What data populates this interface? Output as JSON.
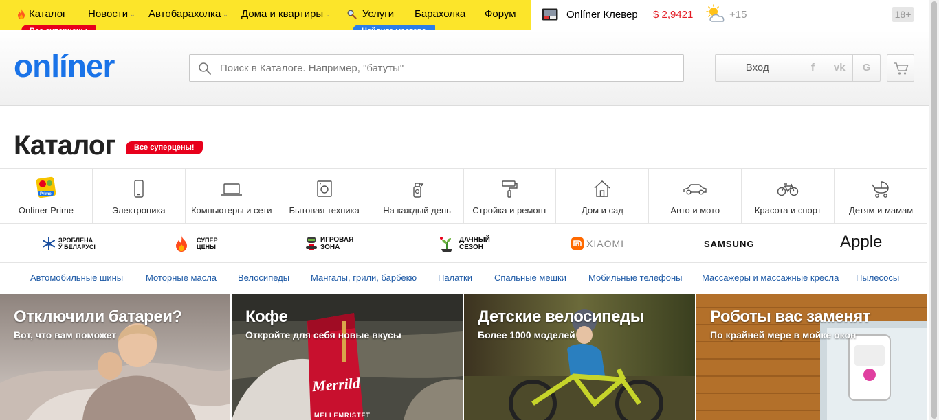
{
  "topnav": {
    "items": [
      {
        "label": "Каталог"
      },
      {
        "label": "Новости"
      },
      {
        "label": "Автобарахолка"
      },
      {
        "label": "Дома и квартиры"
      },
      {
        "label": "Услуги"
      },
      {
        "label": "Барахолка"
      },
      {
        "label": "Форум"
      }
    ],
    "catalog_badge": "Все суперцены",
    "services_badge": "Найдите мастера",
    "clever": "Onlíner Клевер",
    "rate": "$ 2,9421",
    "temperature": "+15",
    "age": "18+"
  },
  "header": {
    "logo": "onlíner",
    "search_placeholder": "Поиск в Каталоге. Например, \"батуты\"",
    "login": "Вход",
    "social": [
      "f",
      "vk",
      "G"
    ]
  },
  "catalog": {
    "title": "Каталог",
    "badge": "Все суперцены!",
    "categories": [
      {
        "label": "Onlíner Prime",
        "icon": "prime-icon"
      },
      {
        "label": "Электроника",
        "icon": "phone-icon"
      },
      {
        "label": "Компьютеры и сети",
        "icon": "laptop-icon"
      },
      {
        "label": "Бытовая техника",
        "icon": "washer-icon"
      },
      {
        "label": "На каждый день",
        "icon": "spray-icon"
      },
      {
        "label": "Стройка и ремонт",
        "icon": "roller-icon"
      },
      {
        "label": "Дом и сад",
        "icon": "house-icon"
      },
      {
        "label": "Авто и мото",
        "icon": "car-icon"
      },
      {
        "label": "Красота и спорт",
        "icon": "bike-icon"
      },
      {
        "label": "Детям и мамам",
        "icon": "stroller-icon"
      }
    ],
    "brands": {
      "belarus": [
        "ЗРОБЛЕНА",
        "Ў БЕЛАРУСІ"
      ],
      "super": [
        "СУПЕР",
        "ЦЕНЫ"
      ],
      "game": [
        "ИГРОВАЯ",
        "ЗОНА"
      ],
      "dacha": [
        "ДАЧНЫЙ",
        "СЕЗОН"
      ],
      "xiaomi": "XIAOMI",
      "samsung": "SAMSUNG",
      "apple": "Apple"
    },
    "quick_links": [
      "Автомобильные шины",
      "Моторные масла",
      "Велосипеды",
      "Мангалы, грили, барбекю",
      "Палатки",
      "Спальные мешки",
      "Мобильные телефоны",
      "Массажеры и массажные кресла",
      "Пылесосы"
    ],
    "tiles": [
      {
        "title": "Отключили батареи?",
        "subtitle": "Вот, что вам поможет"
      },
      {
        "title": "Кофе",
        "subtitle": "Откройте для себя новые вкусы"
      },
      {
        "title": "Детские велосипеды",
        "subtitle": "Более 1000 моделей"
      },
      {
        "title": "Роботы вас заменят",
        "subtitle": "По крайней мере в мойке окон"
      }
    ],
    "coffee_brand": "Merrild",
    "coffee_sub": "MELLEMRISTET"
  },
  "colors": {
    "yellow": "#fce52a",
    "brand_blue": "#1a73e8",
    "badge_red": "#e8001c",
    "badge_blue": "#2b7de9",
    "rate_red": "#e31b23",
    "link_blue": "#1e5aa6"
  }
}
